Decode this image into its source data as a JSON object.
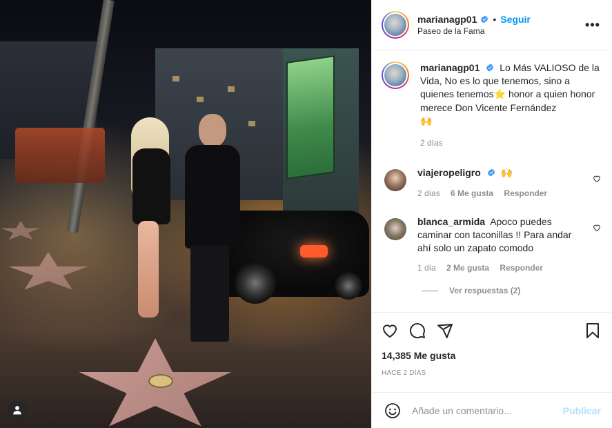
{
  "header": {
    "username": "marianagp01",
    "dot": "•",
    "follow_label": "Seguir",
    "location": "Paseo de la Fama",
    "more_label": "•••"
  },
  "caption": {
    "username": "marianagp01",
    "text_1": "Lo Más VALIOSO de la Vida, No es lo que tenemos, sino a quienes tenemos",
    "emoji_star": "⭐",
    "text_2": "honor a quien honor merece Don Vicente Fernández",
    "emoji_hands": "🙌",
    "time": "2 días"
  },
  "comments": [
    {
      "username": "viajeropeligro",
      "emoji": "🙌",
      "time": "2 días",
      "likes": "6 Me gusta",
      "reply": "Responder"
    },
    {
      "username": "blanca_armida",
      "text": "Apoco puedes caminar con taconillas !! Para andar ahí solo un zapato comodo",
      "time": "1 día",
      "likes": "2 Me gusta",
      "reply": "Responder",
      "view_replies": "Ver respuestas (2)"
    }
  ],
  "stats": {
    "likes": "14,385 Me gusta",
    "posted": "HACE 2 DÍAS"
  },
  "composer": {
    "placeholder": "Añade un comentario...",
    "publish_label": "Publicar"
  },
  "colors": {
    "link_blue": "#0095f6",
    "publish_disabled": "#b2dffc",
    "verified_blue": "#3897f0",
    "secondary_text": "#8e8e8e"
  },
  "icons": [
    "verified-icon",
    "more-icon",
    "heart-icon",
    "comment-icon",
    "share-icon",
    "bookmark-icon",
    "emoji-icon",
    "user-tag-icon"
  ]
}
